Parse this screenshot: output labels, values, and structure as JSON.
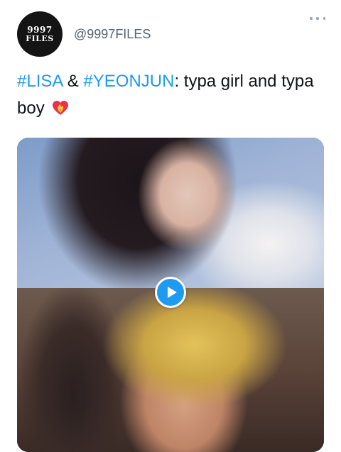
{
  "account": {
    "avatar_line1": "9997",
    "avatar_line2": "FILES",
    "handle": "@9997FILES"
  },
  "tweet": {
    "hashtag_1": "#LISA",
    "connector": " & ",
    "hashtag_2": "#YEONJUN",
    "text_rest": ": typa girl and typa boy",
    "emoji_icon": "heart-on-fire-icon"
  },
  "media": {
    "play_icon": "play-icon"
  },
  "colors": {
    "accent": "#1d9bf0",
    "text": "#0f1419",
    "secondary": "#536471"
  }
}
